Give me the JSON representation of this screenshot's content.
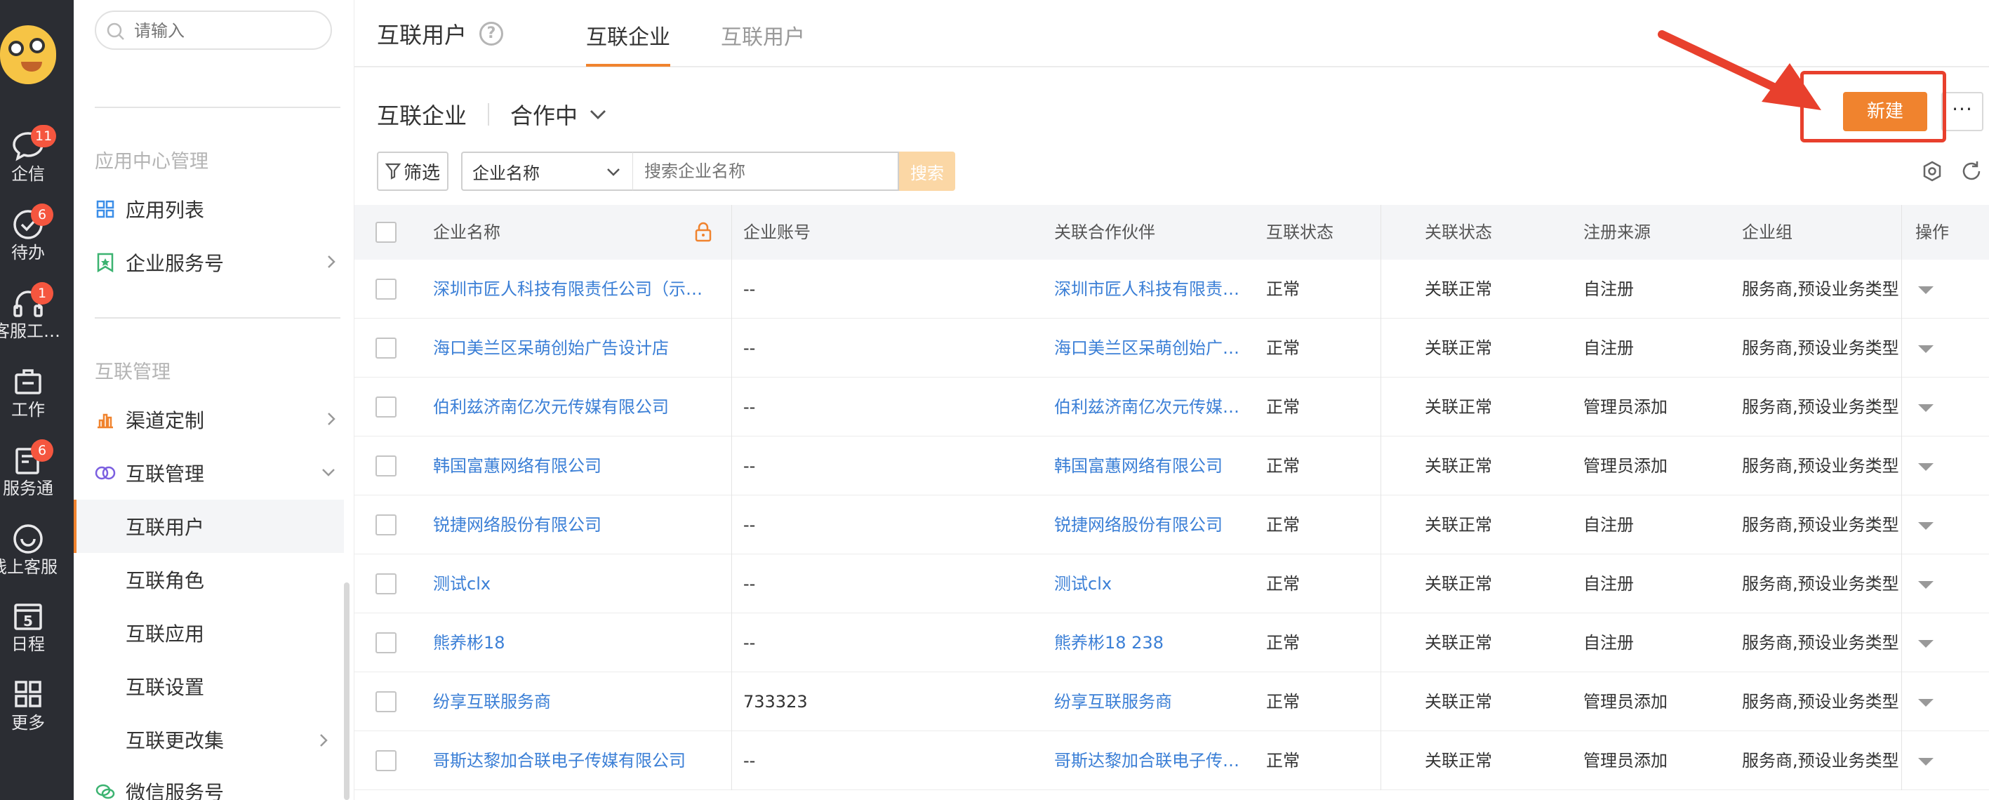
{
  "rail": {
    "items": [
      {
        "label": "企信",
        "badge": "11"
      },
      {
        "label": "待办",
        "badge": "6"
      },
      {
        "label": "客服工…",
        "badge": "1"
      },
      {
        "label": "工作",
        "badge": ""
      },
      {
        "label": "服务通",
        "badge": "6"
      },
      {
        "label": "线上客服",
        "badge": ""
      },
      {
        "label": "日程",
        "badge": "",
        "day": "5"
      },
      {
        "label": "更多",
        "badge": ""
      }
    ]
  },
  "sidebar": {
    "search_placeholder": "请输入",
    "group_app": "应用中心管理",
    "app_list": "应用列表",
    "enterprise_service": "企业服务号",
    "group_interconnect": "互联管理",
    "channel": "渠道定制",
    "interconnect_manage": "互联管理",
    "sub": [
      "互联用户",
      "互联角色",
      "互联应用",
      "互联设置",
      "互联更改集"
    ],
    "wechat": "微信服务号"
  },
  "header": {
    "title": "互联用户",
    "help": "?",
    "tabs": [
      "互联企业",
      "互联用户"
    ]
  },
  "list": {
    "title": "互联企业",
    "status": "合作中",
    "new_label": "新建",
    "more_label": "···"
  },
  "filters": {
    "filter_label": "筛选",
    "field": "企业名称",
    "search_placeholder": "搜索企业名称",
    "search_label": "搜索"
  },
  "table": {
    "columns": [
      "企业名称",
      "企业账号",
      "关联合作伙伴",
      "互联状态",
      "关联状态",
      "注册来源",
      "企业组",
      "操作"
    ],
    "rows": [
      [
        "深圳市匠人科技有限责任公司（示…",
        "--",
        "深圳市匠人科技有限责…",
        "正常",
        "关联正常",
        "自注册",
        "服务商,预设业务类型"
      ],
      [
        "海口美兰区呆萌创始广告设计店",
        "--",
        "海口美兰区呆萌创始广…",
        "正常",
        "关联正常",
        "自注册",
        "服务商,预设业务类型"
      ],
      [
        "伯利兹济南亿次元传媒有限公司",
        "--",
        "伯利兹济南亿次元传媒…",
        "正常",
        "关联正常",
        "管理员添加",
        "服务商,预设业务类型"
      ],
      [
        "韩国富蕙网络有限公司",
        "--",
        "韩国富蕙网络有限公司",
        "正常",
        "关联正常",
        "管理员添加",
        "服务商,预设业务类型"
      ],
      [
        "锐捷网络股份有限公司",
        "--",
        "锐捷网络股份有限公司",
        "正常",
        "关联正常",
        "自注册",
        "服务商,预设业务类型"
      ],
      [
        "测试clx",
        "--",
        "测试clx",
        "正常",
        "关联正常",
        "自注册",
        "服务商,预设业务类型"
      ],
      [
        "熊养彬18",
        "--",
        "熊养彬18  238",
        "正常",
        "关联正常",
        "自注册",
        "服务商,预设业务类型"
      ],
      [
        "纷享互联服务商",
        "733323",
        "纷享互联服务商",
        "正常",
        "关联正常",
        "管理员添加",
        "服务商,预设业务类型"
      ],
      [
        "哥斯达黎加合联电子传媒有限公司",
        "--",
        "哥斯达黎加合联电子传…",
        "正常",
        "关联正常",
        "管理员添加",
        "服务商,预设业务类型"
      ]
    ]
  },
  "colors": {
    "accent": "#f0832e",
    "link": "#3b7fd6",
    "rail": "#2b2d33",
    "highlight": "#e8402d"
  }
}
